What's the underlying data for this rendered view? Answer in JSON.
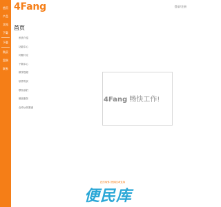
{
  "sidebar": {
    "items": [
      {
        "label": "首页"
      },
      {
        "label": "产品"
      },
      {
        "label": "文档"
      },
      {
        "label": "下载"
      },
      {
        "label": "下载"
      },
      {
        "label": "购买"
      },
      {
        "label": "案例"
      },
      {
        "label": "联系"
      }
    ]
  },
  "header": {
    "logo": "4Fang",
    "top_link": "登录/注册"
  },
  "main": {
    "title": "首页",
    "menu": [
      {
        "label": "系统介绍"
      },
      {
        "label": "功能中心"
      },
      {
        "label": "问题讨论"
      },
      {
        "label": "下载中心"
      },
      {
        "label": "教学视频"
      },
      {
        "label": "软件购买"
      },
      {
        "label": "联系我们"
      },
      {
        "label": "微信服务"
      },
      {
        "label": "合作伙伴渠道"
      }
    ],
    "hero": {
      "brand": "4Fang",
      "slogan": "畅快工作!"
    }
  },
  "footer": {
    "small_text": "四方软件 提供技术支持",
    "banner": "便民库"
  },
  "colors": {
    "accent": "#f57e17",
    "banner": "#2aa7d6"
  }
}
